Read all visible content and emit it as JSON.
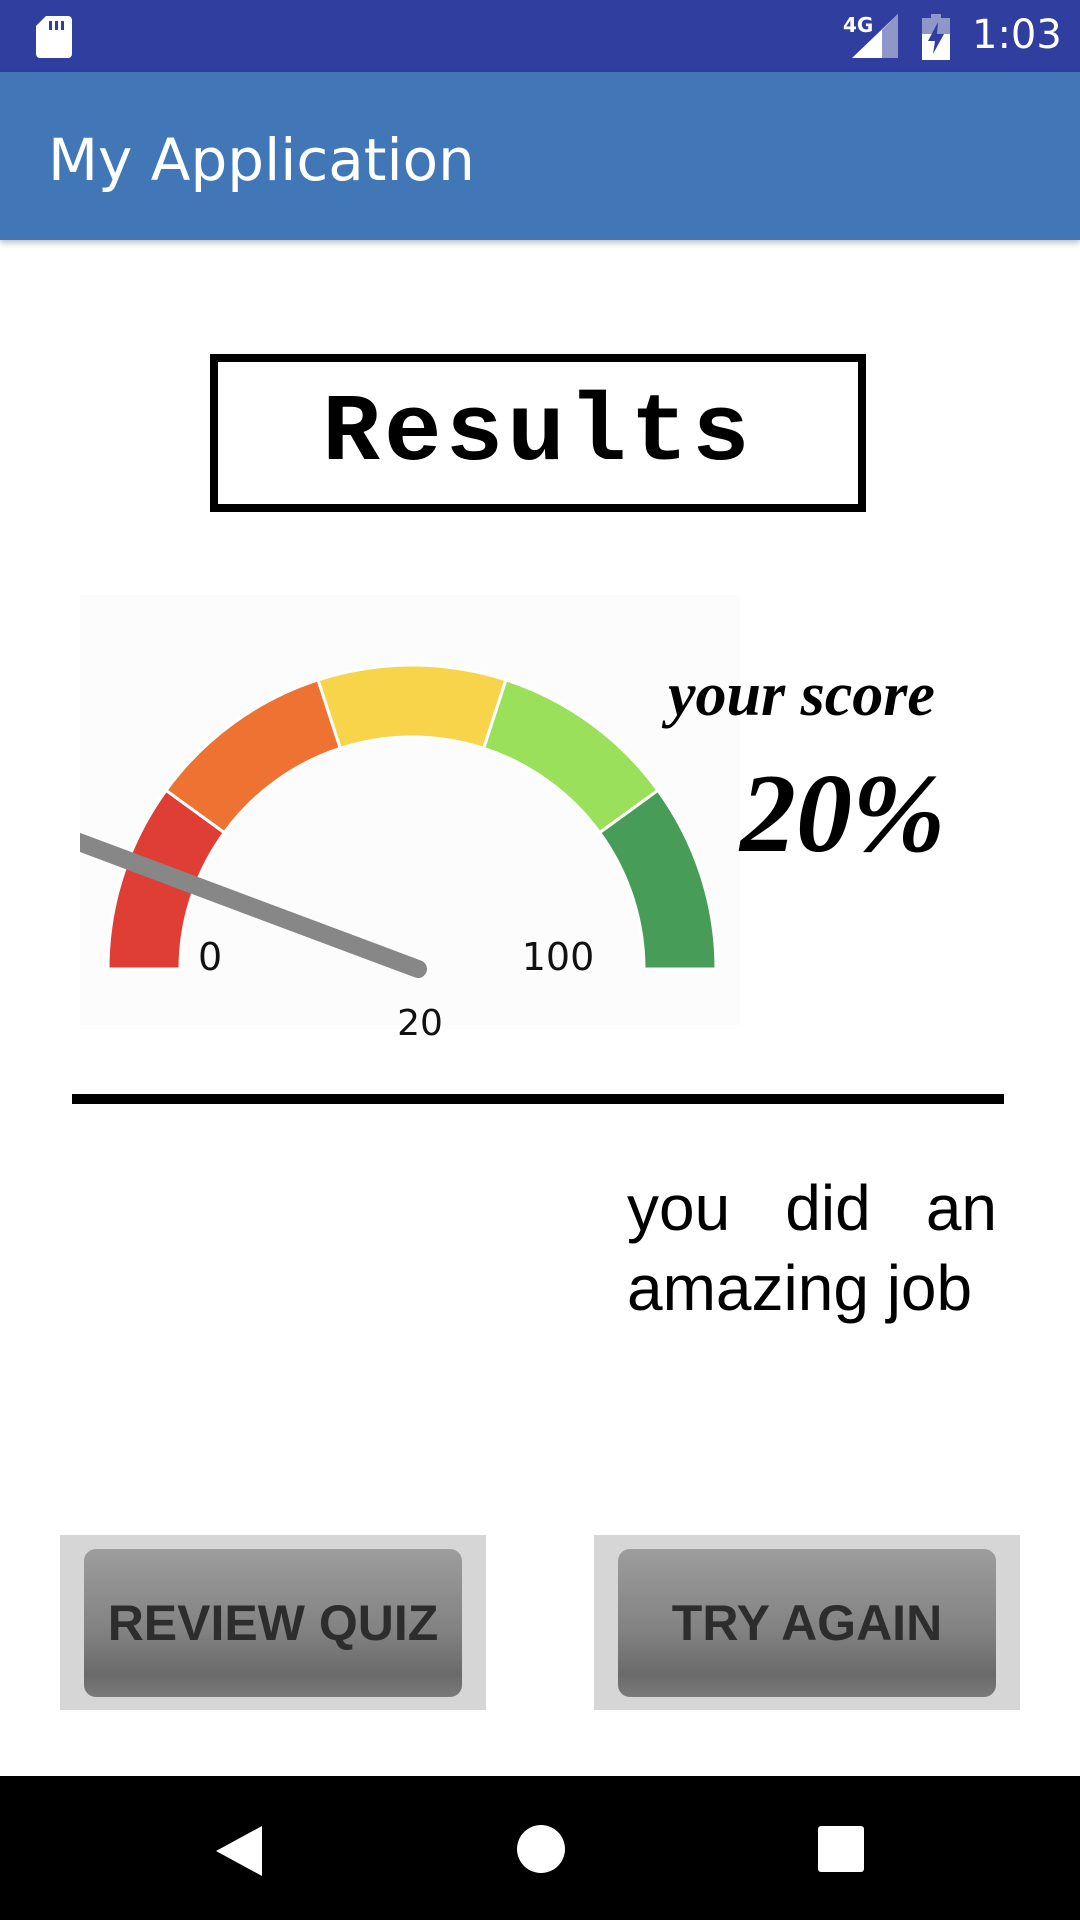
{
  "status_bar": {
    "network_type": "4G",
    "time": "1:03",
    "icons": [
      "sd-card-icon",
      "signal-icon",
      "battery-charging-icon"
    ]
  },
  "app_bar": {
    "title": "My Application"
  },
  "results": {
    "heading": "Results"
  },
  "gauge": {
    "min_label": "0",
    "max_label": "100",
    "needle_value": 20,
    "bubble_label": "20",
    "value_label": "20",
    "segment_colors": [
      "#df3e35",
      "#ee7231",
      "#f7d44a",
      "#9be05b",
      "#479d57"
    ]
  },
  "score": {
    "label": "your score",
    "value": "20%"
  },
  "message": "you did an amazing job",
  "buttons": {
    "review": "REVIEW QUIZ",
    "try_again": "TRY AGAIN"
  },
  "nav_bar": {
    "icons": [
      "back-icon",
      "home-icon",
      "recents-icon"
    ]
  },
  "colors": {
    "status_bar": "#303f9f",
    "app_bar": "#4177b7"
  }
}
